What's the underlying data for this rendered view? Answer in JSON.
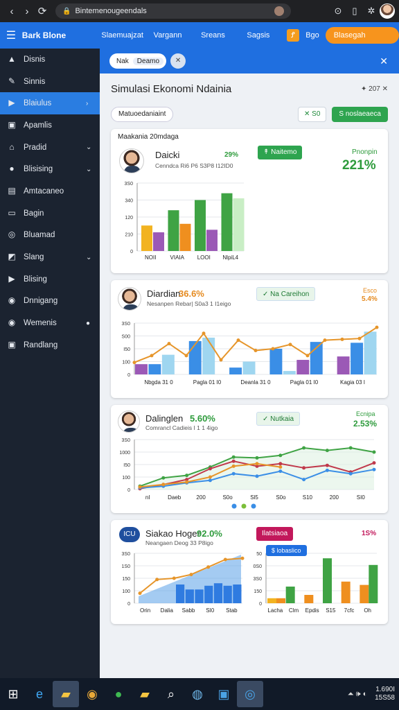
{
  "browser": {
    "address": "Bintemenougeendals",
    "back": "‹",
    "forward": "›"
  },
  "topbar": {
    "brand": "Bark Blone",
    "nav": [
      "Slaemuajzat",
      "Vargann",
      "Sreans",
      "Sagsis"
    ],
    "badge_icon": "Ꝭ",
    "badge_text": "Bgo",
    "cta": "Blasegah Carnme"
  },
  "sidebar": {
    "items": [
      {
        "label": "Disnis",
        "icon": "▲",
        "chev": ""
      },
      {
        "label": "Sinnis",
        "icon": "✎",
        "chev": ""
      },
      {
        "label": "Blaiulus",
        "icon": "▶",
        "chev": "›",
        "active": true
      },
      {
        "label": "Apamlis",
        "icon": "▣",
        "chev": ""
      },
      {
        "label": "Pradid",
        "icon": "⌂",
        "chev": "⌄"
      },
      {
        "label": "Blisising",
        "icon": "●",
        "chev": "⌄"
      },
      {
        "label": "Amtacaneo",
        "icon": "▤",
        "chev": ""
      },
      {
        "label": "Bagin",
        "icon": "▭",
        "chev": ""
      },
      {
        "label": "Bluamad",
        "icon": "◎",
        "chev": ""
      },
      {
        "label": "Slang",
        "icon": "◩",
        "chev": "⌄"
      },
      {
        "label": "Blising",
        "icon": "▶",
        "chev": ""
      },
      {
        "label": "Dnnigang",
        "icon": "◉",
        "chev": ""
      },
      {
        "label": "Wemenis",
        "icon": "◉",
        "chev": "●"
      },
      {
        "label": "Randlang",
        "icon": "▣",
        "chev": ""
      }
    ]
  },
  "tabs": {
    "tab1": "Nak",
    "tab2": "Deamo",
    "close": "✕"
  },
  "page": {
    "title": "Simulasi Ekonomi Ndainia",
    "meta": "207",
    "filter": "Matuoedaniaint",
    "btn_outline": "✕  S0",
    "btn_green": "S noslaeaeca"
  },
  "cards": [
    {
      "header": "Maakania  20mdaga",
      "name": "Daicki",
      "pct": "29%",
      "sub": "Cenndca Ri6 P6 S3P8 I12ID0",
      "tag": "Naitemo",
      "right_label": "Pnonpin",
      "big": "221%",
      "chart_data": {
        "type": "bar",
        "categories": [
          "NOII",
          "VIAIA",
          "LOOI",
          "NlpiL4"
        ],
        "yticks": [
          "3S0",
          "340",
          "120",
          "210",
          "0"
        ],
        "series": [
          {
            "name": "",
            "color": "#f2b321",
            "values": [
              150,
              0,
              0,
              0
            ]
          },
          {
            "name": "",
            "color": "#9b59b6",
            "values": [
              110,
              0,
              0,
              0
            ]
          },
          {
            "name": "",
            "color": "#3fa344",
            "values": [
              0,
              240,
              0,
              0
            ]
          },
          {
            "name": "",
            "color": "#ef8f1f",
            "values": [
              0,
              160,
              0,
              0
            ]
          },
          {
            "name": "",
            "color": "#3fa344",
            "values": [
              0,
              0,
              300,
              0
            ]
          },
          {
            "name": "",
            "color": "#9b59b6",
            "values": [
              0,
              0,
              125,
              0
            ]
          },
          {
            "name": "",
            "color": "#3fa344",
            "values": [
              0,
              0,
              0,
              340
            ]
          },
          {
            "name": "",
            "color": "#c9eec5",
            "values": [
              0,
              0,
              0,
              310
            ]
          }
        ],
        "ylim": [
          0,
          400
        ]
      }
    },
    {
      "name": "Diardian",
      "pct": "36.6%",
      "sub": "Nesanpen Rebar| S0a3 1 I1eigo",
      "tag": "Na Careihon",
      "right_label": "Esco",
      "right_val": "5.4%",
      "chart_data": {
        "type": "bar",
        "categories": [
          "Nbgda 31 0",
          "Pagla 01 I0",
          "Deanla 31 0",
          "Pagla 01 I0",
          "Kagia 03 I"
        ],
        "yticks": [
          "3S0",
          "S00",
          "I50",
          "100",
          "0"
        ],
        "bars": [
          60,
          60,
          115,
          0,
          195,
          215,
          0,
          40,
          75,
          0,
          150,
          20,
          85,
          190,
          0,
          105,
          185,
          250
        ],
        "line": [
          70,
          110,
          180,
          110,
          240,
          85,
          200,
          140,
          150,
          175,
          110,
          200,
          205,
          210,
          275
        ],
        "ylim": [
          0,
          300
        ]
      }
    },
    {
      "name": "Dalinglen",
      "pct": "5.60%",
      "sub": "Comrancl Cadieis I 1 1 4igo",
      "tag": "Nutkaia",
      "right_label": "Ecnipa",
      "right_val": "2.53%",
      "chart_data": {
        "type": "line",
        "categories": [
          "nI",
          "Daeb",
          "200",
          "S0o",
          "Sl5",
          "S0o",
          "S10",
          "200",
          "SI0"
        ],
        "yticks": [
          "3S0",
          "1000",
          "I50",
          "100",
          "0"
        ],
        "series": [
          {
            "name": "",
            "color": "#3fa344",
            "values": [
              20,
              70,
              85,
              135,
              195,
              190,
              205,
              250,
              235,
              250,
              225
            ]
          },
          {
            "name": "",
            "color": "#c0394b",
            "values": [
              5,
              30,
              60,
              125,
              170,
              140,
              155,
              130,
              145,
              105,
              160
            ]
          },
          {
            "name": "",
            "color": "#3a8ee6",
            "values": [
              10,
              20,
              40,
              55,
              95,
              80,
              110,
              60,
              115,
              95,
              120
            ]
          },
          {
            "name": "",
            "color": "#e6952a",
            "values": [
              15,
              30,
              45,
              75,
              140,
              155,
              135,
              0,
              0,
              0,
              0
            ]
          }
        ],
        "ylim": [
          0,
          300
        ]
      }
    },
    {
      "name": "Siakao Hoger",
      "pct": "92.0%",
      "sub": "Neangaen Deog 33 P8igo",
      "tag": "Ilatsiaoa",
      "right_val": "1S%",
      "logo": "ICU",
      "chip": "$ lobaslico",
      "chart_data": [
        {
          "type": "area",
          "categories": [
            "Orin",
            "Dalia",
            "Sabb",
            "SI0",
            "Stab"
          ],
          "yticks": [
            "3S0",
            "1S0",
            "150",
            "100",
            "0"
          ],
          "bars": [
            75,
            55,
            55,
            70,
            80,
            70,
            75
          ],
          "line": [
            40,
            95,
            100,
            115,
            145,
            175,
            180
          ],
          "ylim": [
            0,
            200
          ]
        },
        {
          "type": "bar",
          "categories": [
            "Lacha",
            "Clm",
            "Epdis",
            "S15",
            "7cfc",
            "Oh"
          ],
          "yticks": [
            "50",
            "0S0",
            "3S0",
            "150",
            "0"
          ],
          "series": [
            {
              "name": "",
              "color": "#f2b321",
              "values": [
                15,
                0,
                0,
                0,
                0,
                0
              ]
            },
            {
              "name": "",
              "color": "#ef8f1f",
              "values": [
                15,
                0,
                25,
                0,
                65,
                55
              ]
            },
            {
              "name": "",
              "color": "#3fa344",
              "values": [
                0,
                50,
                0,
                135,
                0,
                115
              ]
            }
          ],
          "ylim": [
            0,
            150
          ]
        }
      ]
    }
  ],
  "taskbar": {
    "time": "1.690I",
    "date": "15S58",
    "tray": "⏶ 🕪 ◐"
  }
}
